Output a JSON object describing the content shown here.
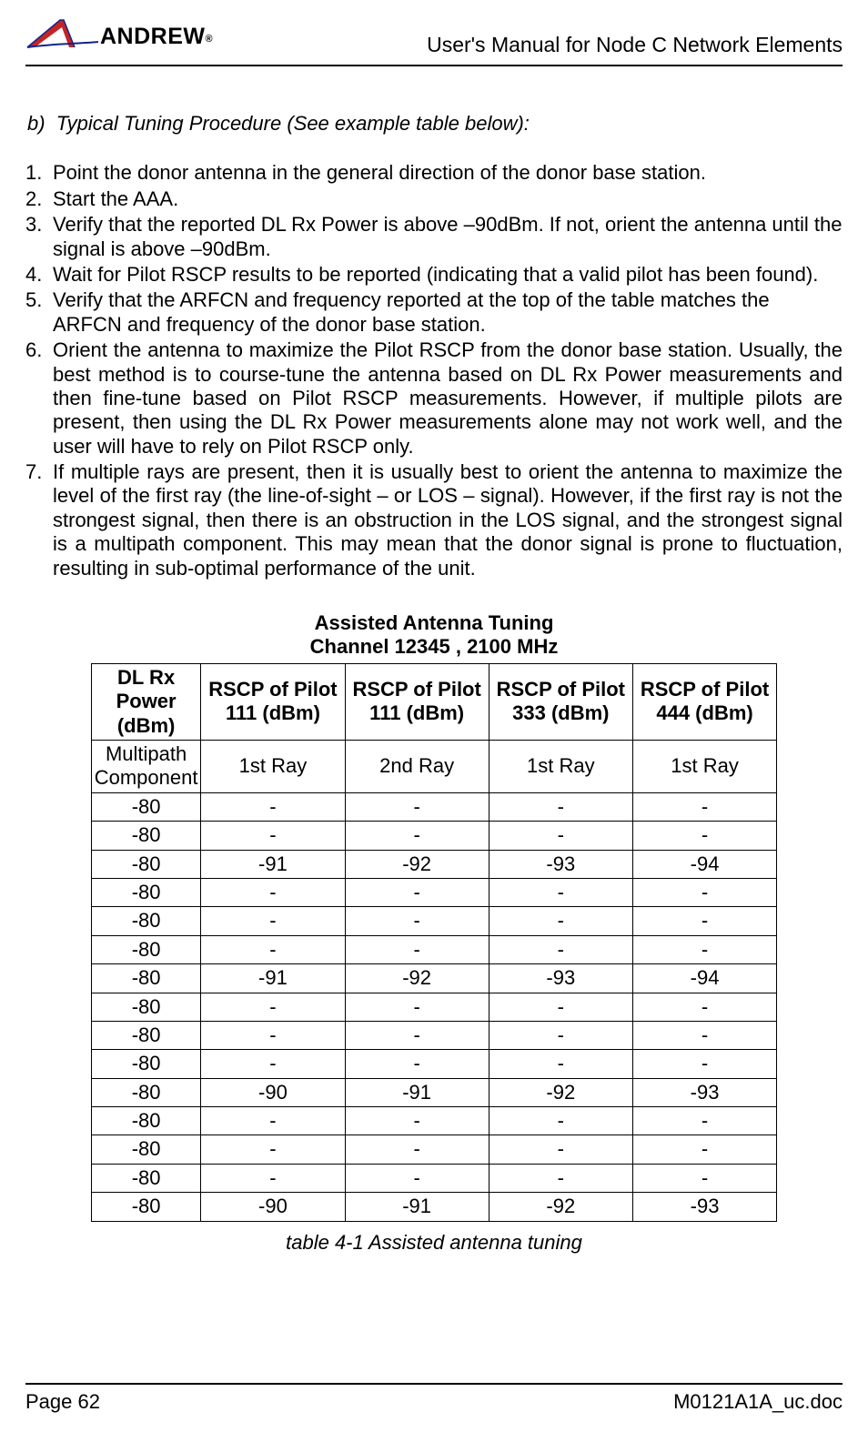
{
  "header": {
    "logo_text": "ANDREW",
    "doc_title": "User's Manual for Node C Network Elements"
  },
  "section": {
    "heading_prefix": "b)",
    "heading_text": "Typical Tuning Procedure (See example table below):"
  },
  "steps": [
    "Point the donor antenna in the general direction of the donor base station.",
    "Start the AAA.",
    "Verify that the reported DL Rx Power is above –90dBm.  If not, orient the antenna until the signal is above –90dBm.",
    "Wait for Pilot RSCP results to be reported (indicating that a valid pilot has been found).",
    "Verify that the ARFCN and frequency reported at the top of the table matches the ARFCN and frequency of the donor base station.",
    "Orient the antenna to maximize the Pilot RSCP from the donor base station. Usually, the best method is to course-tune the antenna based on DL Rx Power measurements and then fine-tune based on Pilot RSCP measurements. However, if multiple pilots are present, then using the DL Rx Power measurements alone may not work well, and the user will have to rely on Pilot RSCP only.",
    "If multiple rays are present, then it is usually best to orient the antenna to maximize the level of the first ray (the line-of-sight – or LOS – signal). However, if the first ray is not the strongest signal, then there is an obstruction in the LOS signal, and the strongest signal is a multipath component. This may mean that the donor signal is prone to fluctuation, resulting in sub-optimal performance of the unit."
  ],
  "table": {
    "title_line1": "Assisted Antenna Tuning",
    "title_line2": "Channel 12345 , 2100 MHz",
    "headers": [
      "DL Rx Power (dBm)",
      "RSCP of Pilot 111 (dBm)",
      "RSCP of Pilot 111 (dBm)",
      "RSCP of Pilot 333 (dBm)",
      "RSCP of Pilot 444 (dBm)"
    ],
    "component_row": [
      "Multipath Component",
      "1st Ray",
      "2nd Ray",
      "1st Ray",
      "1st Ray"
    ],
    "rows": [
      [
        "-80",
        "-",
        "-",
        "-",
        "-"
      ],
      [
        "-80",
        "-",
        "-",
        "-",
        "-"
      ],
      [
        "-80",
        "-91",
        "-92",
        "-93",
        "-94"
      ],
      [
        "-80",
        "-",
        "-",
        "-",
        "-"
      ],
      [
        "-80",
        "-",
        "-",
        "-",
        "-"
      ],
      [
        "-80",
        "-",
        "-",
        "-",
        "-"
      ],
      [
        "-80",
        "-91",
        "-92",
        "-93",
        "-94"
      ],
      [
        "-80",
        "-",
        "-",
        "-",
        "-"
      ],
      [
        "-80",
        "-",
        "-",
        "-",
        "-"
      ],
      [
        "-80",
        "-",
        "-",
        "-",
        "-"
      ],
      [
        "-80",
        "-90",
        "-91",
        "-92",
        "-93"
      ],
      [
        "-80",
        "-",
        "-",
        "-",
        "-"
      ],
      [
        "-80",
        "-",
        "-",
        "-",
        "-"
      ],
      [
        "-80",
        "-",
        "-",
        "-",
        "-"
      ],
      [
        "-80",
        "-90",
        "-91",
        "-92",
        "-93"
      ]
    ],
    "caption": "table 4-1 Assisted antenna tuning"
  },
  "footer": {
    "page_label": "Page 62",
    "doc_label": "M0121A1A_uc.doc"
  },
  "chart_data": {
    "type": "table",
    "title": "Assisted Antenna Tuning — Channel 12345 , 2100 MHz",
    "columns": [
      "DL Rx Power (dBm)",
      "RSCP of Pilot 111 (dBm) 1st Ray",
      "RSCP of Pilot 111 (dBm) 2nd Ray",
      "RSCP of Pilot 333 (dBm) 1st Ray",
      "RSCP of Pilot 444 (dBm) 1st Ray"
    ],
    "rows": [
      [
        -80,
        null,
        null,
        null,
        null
      ],
      [
        -80,
        null,
        null,
        null,
        null
      ],
      [
        -80,
        -91,
        -92,
        -93,
        -94
      ],
      [
        -80,
        null,
        null,
        null,
        null
      ],
      [
        -80,
        null,
        null,
        null,
        null
      ],
      [
        -80,
        null,
        null,
        null,
        null
      ],
      [
        -80,
        -91,
        -92,
        -93,
        -94
      ],
      [
        -80,
        null,
        null,
        null,
        null
      ],
      [
        -80,
        null,
        null,
        null,
        null
      ],
      [
        -80,
        null,
        null,
        null,
        null
      ],
      [
        -80,
        -90,
        -91,
        -92,
        -93
      ],
      [
        -80,
        null,
        null,
        null,
        null
      ],
      [
        -80,
        null,
        null,
        null,
        null
      ],
      [
        -80,
        null,
        null,
        null,
        null
      ],
      [
        -80,
        -90,
        -91,
        -92,
        -93
      ]
    ]
  }
}
